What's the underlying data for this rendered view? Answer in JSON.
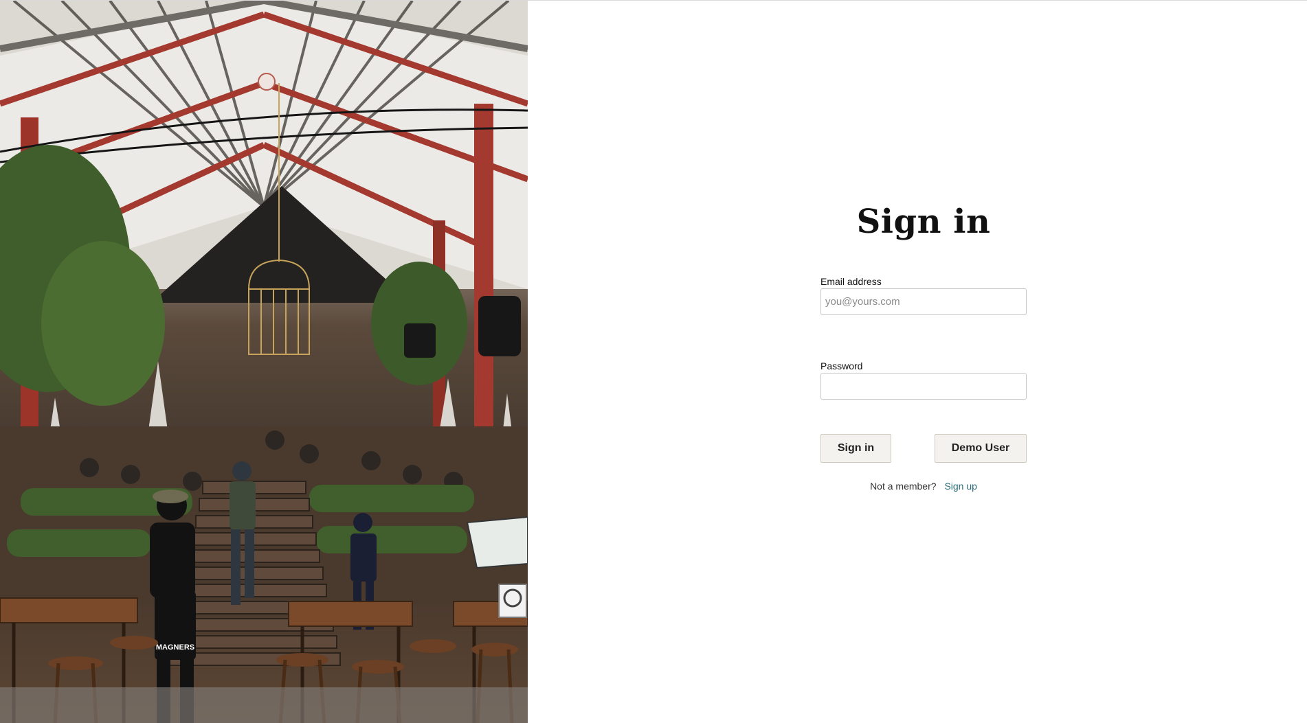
{
  "photo": {
    "apron_text": "MAGNERS"
  },
  "signin": {
    "title": "Sign in",
    "email_label": "Email address",
    "email_placeholder": "you@yours.com",
    "email_value": "",
    "password_label": "Password",
    "password_value": "",
    "signin_button": "Sign in",
    "demo_button": "Demo User",
    "member_prompt": "Not a member?",
    "signup_link": "Sign up"
  },
  "colors": {
    "button_background": "#f4f2ee",
    "link": "#2a6b78",
    "title": "#111111"
  }
}
